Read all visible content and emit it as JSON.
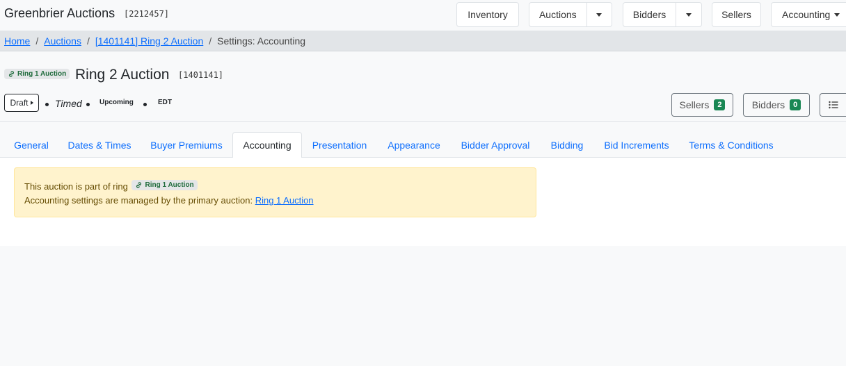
{
  "brand": {
    "name": "Greenbrier Auctions",
    "id": "[2212457]"
  },
  "nav": {
    "inventory": "Inventory",
    "auctions": "Auctions",
    "bidders": "Bidders",
    "sellers": "Sellers",
    "accounting": "Accounting"
  },
  "breadcrumb": {
    "home": "Home",
    "auctions": "Auctions",
    "auction": "[1401141] Ring 2 Auction",
    "current": "Settings: Accounting",
    "sep": "/"
  },
  "header": {
    "ring_badge": "Ring 1 Auction",
    "title": "Ring 2 Auction",
    "id": "[1401141]",
    "status": "Draft",
    "type": "Timed",
    "state": "Upcoming",
    "timezone": "EDT",
    "sellers_label": "Sellers",
    "sellers_count": "2",
    "bidders_label": "Bidders",
    "bidders_count": "0"
  },
  "tabs": [
    "General",
    "Dates & Times",
    "Buyer Premiums",
    "Accounting",
    "Presentation",
    "Appearance",
    "Bidder Approval",
    "Bidding",
    "Bid Increments",
    "Terms & Conditions"
  ],
  "alert": {
    "line1": "This auction is part of ring",
    "ring_badge": "Ring 1 Auction",
    "line2": "Accounting settings are managed by the primary auction:",
    "link": "Ring 1 Auction"
  },
  "colors": {
    "link": "#0d6efd",
    "badge_green": "#198754",
    "alert_bg": "#fff3cd"
  }
}
